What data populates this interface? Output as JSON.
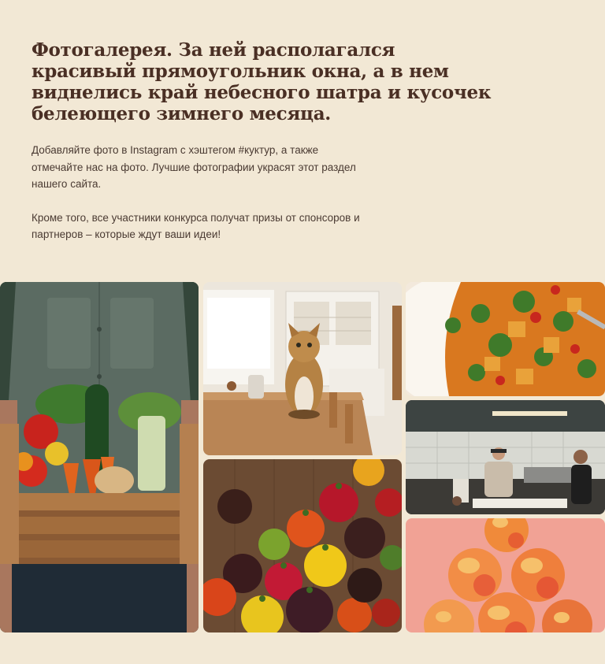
{
  "gallery_section": {
    "title": "Фотогалерея. За ней располагался красивый прямоугольник окна, а в нем виднелись край небесного шатра и кусочек белеющего зимнего месяца.",
    "paragraph_1": "Добавляйте фото в Instagram с хэштегом #куктур, а также отмечайте нас на фото. Лучшие фотографии украсят этот раздел нашего сайта.",
    "paragraph_2": "Кроме того, все участники конкурса получат призы от спонсоров и партнеров – которые ждут ваши идеи!"
  },
  "photos": [
    {
      "subject": "farmer-vegetable-crate"
    },
    {
      "subject": "cat-on-table"
    },
    {
      "subject": "rice-with-curry"
    },
    {
      "subject": "restaurant-kitchen-chefs"
    },
    {
      "subject": "heirloom-tomatoes"
    },
    {
      "subject": "peaches-pile"
    }
  ],
  "colors": {
    "background": "#f2e8d5",
    "heading": "#4a2f24",
    "body_text": "#4a3a32"
  }
}
